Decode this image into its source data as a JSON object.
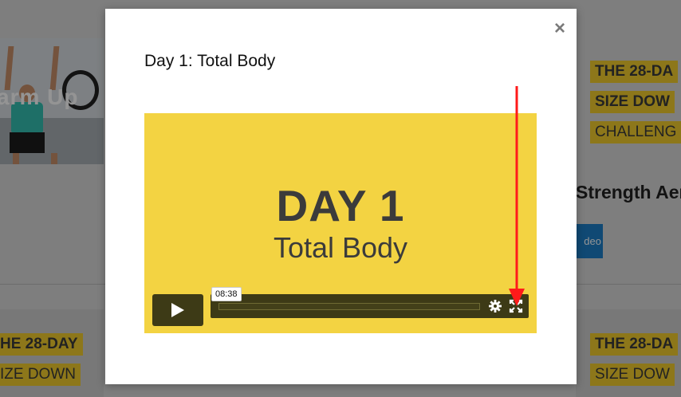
{
  "background": {
    "left_card_label": "arm Up",
    "banner_top": [
      "THE 28-DA",
      "SIZE DOW",
      "CHALLENG"
    ],
    "strength_text": "Strength Aer",
    "video_button_label": "deo",
    "bottom_left_banners": [
      "HE 28-DAY",
      "IZE DOWN"
    ],
    "bottom_right_banners": [
      "THE 28-DA",
      "SIZE DOW"
    ]
  },
  "modal": {
    "title": "Day 1: Total Body",
    "close_symbol": "×"
  },
  "video": {
    "poster_line1": "DAY 1",
    "poster_line2": "Total Body",
    "duration": "08:38",
    "progress_fraction": 0,
    "colors": {
      "poster_bg": "#f3d342",
      "controls_bg": "#3d3a16",
      "annotation_arrow": "#ff1a1a"
    }
  },
  "icons": {
    "play": "play-icon",
    "settings": "gear-icon",
    "fullscreen": "fullscreen-icon",
    "close": "close-icon"
  }
}
